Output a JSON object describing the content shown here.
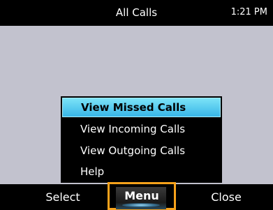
{
  "status_bar": {
    "title": "All Calls",
    "time": "1:21 PM"
  },
  "menu": {
    "items": [
      {
        "label": "View Missed Calls",
        "selected": true
      },
      {
        "label": "View Incoming Calls",
        "selected": false
      },
      {
        "label": "View Outgoing Calls",
        "selected": false
      },
      {
        "label": "Help",
        "selected": false
      }
    ]
  },
  "softkeys": {
    "select_label": "Select",
    "menu_label": "Menu",
    "close_label": "Close"
  },
  "colors": {
    "highlight": "#38b6e8",
    "focus_outline": "#f7a21b",
    "background": "#c2c2ce"
  }
}
